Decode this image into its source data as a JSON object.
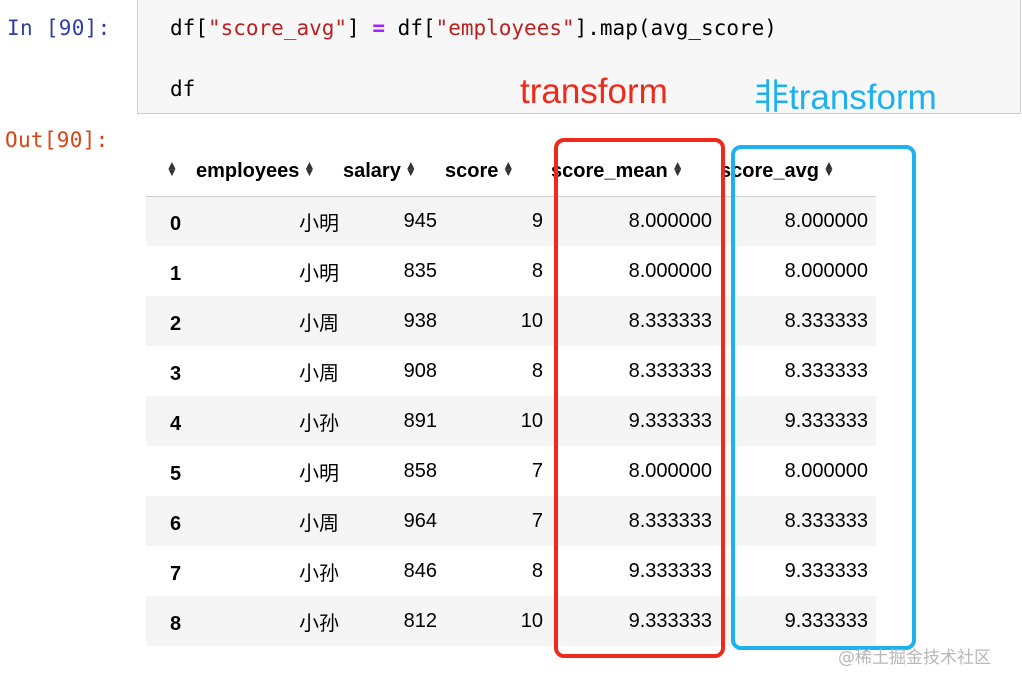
{
  "prompts": {
    "input": "In [90]:",
    "output": "Out[90]:"
  },
  "code": {
    "line1": {
      "p1": "df[",
      "s1": "\"score_avg\"",
      "p2": "] ",
      "op": "=",
      "p3": " df[",
      "s2": "\"employees\"",
      "p4": "].map(avg_score)"
    },
    "line2": "df"
  },
  "annotations": {
    "red_label": "transform",
    "blue_label": "非transform",
    "red_color": "#ee2a1b",
    "blue_color": "#1fb1ee"
  },
  "table": {
    "columns": [
      "employees",
      "salary",
      "score",
      "score_mean",
      "score_avg"
    ],
    "rows": [
      {
        "index": "0",
        "employees": "小明",
        "salary": "945",
        "score": "9",
        "score_mean": "8.000000",
        "score_avg": "8.000000"
      },
      {
        "index": "1",
        "employees": "小明",
        "salary": "835",
        "score": "8",
        "score_mean": "8.000000",
        "score_avg": "8.000000"
      },
      {
        "index": "2",
        "employees": "小周",
        "salary": "938",
        "score": "10",
        "score_mean": "8.333333",
        "score_avg": "8.333333"
      },
      {
        "index": "3",
        "employees": "小周",
        "salary": "908",
        "score": "8",
        "score_mean": "8.333333",
        "score_avg": "8.333333"
      },
      {
        "index": "4",
        "employees": "小孙",
        "salary": "891",
        "score": "10",
        "score_mean": "9.333333",
        "score_avg": "9.333333"
      },
      {
        "index": "5",
        "employees": "小明",
        "salary": "858",
        "score": "7",
        "score_mean": "8.000000",
        "score_avg": "8.000000"
      },
      {
        "index": "6",
        "employees": "小周",
        "salary": "964",
        "score": "7",
        "score_mean": "8.333333",
        "score_avg": "8.333333"
      },
      {
        "index": "7",
        "employees": "小孙",
        "salary": "846",
        "score": "8",
        "score_mean": "9.333333",
        "score_avg": "9.333333"
      },
      {
        "index": "8",
        "employees": "小孙",
        "salary": "812",
        "score": "10",
        "score_mean": "9.333333",
        "score_avg": "9.333333"
      }
    ]
  },
  "watermark": "@稀土掘金技术社区"
}
